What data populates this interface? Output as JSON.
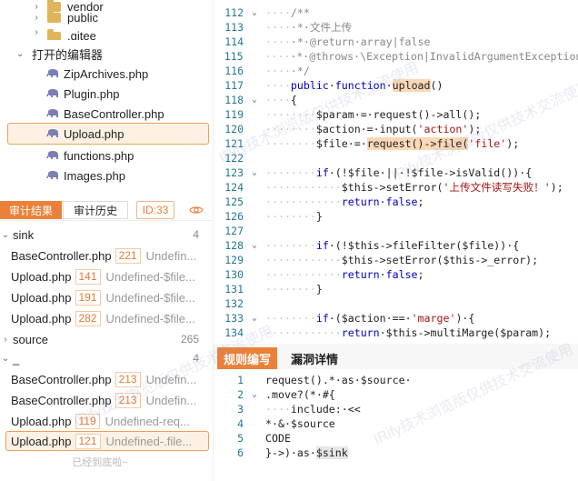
{
  "explorer": {
    "tree": [
      {
        "label": "vendor"
      },
      {
        "label": "public"
      },
      {
        "label": ".gitee"
      }
    ],
    "open_editors_title": "打开的编辑器",
    "open_files": [
      {
        "label": "ZipArchives.php"
      },
      {
        "label": "Plugin.php"
      },
      {
        "label": "BaseController.php"
      },
      {
        "label": "Upload.php"
      },
      {
        "label": "functions.php"
      },
      {
        "label": "Images.php"
      }
    ]
  },
  "audit": {
    "tab_results": "审计结果",
    "tab_history": "审计历史",
    "id_badge": "ID:33",
    "groups": [
      {
        "name": "sink",
        "count": "4",
        "items": [
          {
            "file": "BaseController.php",
            "line": "221",
            "msg": "Undefin..."
          },
          {
            "file": "Upload.php",
            "line": "141",
            "msg": "Undefined-$file..."
          },
          {
            "file": "Upload.php",
            "line": "191",
            "msg": "Undefined-$file..."
          },
          {
            "file": "Upload.php",
            "line": "282",
            "msg": "Undefined-$file..."
          }
        ]
      },
      {
        "name": "source",
        "count": "265"
      },
      {
        "name": "_",
        "count": "4",
        "items": [
          {
            "file": "BaseController.php",
            "line": "213",
            "msg": "Undefin..."
          },
          {
            "file": "BaseController.php",
            "line": "213",
            "msg": "Undefin..."
          },
          {
            "file": "Upload.php",
            "line": "119",
            "msg": "Undefined-req..."
          },
          {
            "file": "Upload.php",
            "line": "121",
            "msg": "Undefined-.file..."
          }
        ]
      }
    ],
    "end_text": "已经到底啦~"
  },
  "editor": {
    "lines": [
      {
        "n": "112",
        "fold": "⌄",
        "html": "<span class='dots'>····</span><span class='cm'>/**</span>"
      },
      {
        "n": "113",
        "fold": "",
        "html": "<span class='dots'>····</span><span class='cm'>·*·文件上传</span>"
      },
      {
        "n": "114",
        "fold": "",
        "html": "<span class='dots'>····</span><span class='cm'>·*·@return·array|false</span>"
      },
      {
        "n": "115",
        "fold": "",
        "html": "<span class='dots'>····</span><span class='cm'>·*·@throws·\\Exception|InvalidArgumentException</span>"
      },
      {
        "n": "116",
        "fold": "",
        "html": "<span class='dots'>····</span><span class='cm'>·*/</span>"
      },
      {
        "n": "117",
        "fold": "",
        "html": "<span class='dots'>····</span><span class='kw'>public</span>·<span class='kw'>function</span>·<span class='hl'>upload</span>()"
      },
      {
        "n": "118",
        "fold": "⌄",
        "html": "<span class='dots'>····</span>{"
      },
      {
        "n": "119",
        "fold": "",
        "html": "<span class='dots'>········</span>$param·=·request()->all();"
      },
      {
        "n": "120",
        "fold": "",
        "html": "<span class='dots'>········</span>$action·=·input(<span class='str'>'action'</span>);"
      },
      {
        "n": "121",
        "fold": "",
        "html": "<span class='dots'>········</span>$file·=·<span class='hl'>request()->file(</span><span class='str'>'file'</span>);"
      },
      {
        "n": "122",
        "fold": "",
        "html": ""
      },
      {
        "n": "123",
        "fold": "⌄",
        "html": "<span class='dots'>········</span><span class='kw'>if</span>·(!$file·||·!$file->isValid())·{"
      },
      {
        "n": "124",
        "fold": "",
        "html": "<span class='dots'>············</span>$this->setError(<span class='str'>'上传文件读写失败！'</span>);"
      },
      {
        "n": "125",
        "fold": "",
        "html": "<span class='dots'>············</span><span class='kw'>return</span>·<span class='kw'>false</span>;"
      },
      {
        "n": "126",
        "fold": "",
        "html": "<span class='dots'>········</span>}"
      },
      {
        "n": "127",
        "fold": "",
        "html": ""
      },
      {
        "n": "128",
        "fold": "⌄",
        "html": "<span class='dots'>········</span><span class='kw'>if</span>·(!$this->fileFilter($file))·{"
      },
      {
        "n": "129",
        "fold": "",
        "html": "<span class='dots'>············</span>$this->setError($this->_error);"
      },
      {
        "n": "130",
        "fold": "",
        "html": "<span class='dots'>············</span><span class='kw'>return</span>·<span class='kw'>false</span>;"
      },
      {
        "n": "131",
        "fold": "",
        "html": "<span class='dots'>········</span>}"
      },
      {
        "n": "132",
        "fold": "",
        "html": ""
      },
      {
        "n": "133",
        "fold": "⌄",
        "html": "<span class='dots'>········</span><span class='kw'>if</span>·($action·==·<span class='str'>'marge'</span>)·{"
      },
      {
        "n": "134",
        "fold": "",
        "html": "<span class='dots'>············</span><span class='kw'>return</span>·$this->multiMarge($param);"
      }
    ]
  },
  "rule_panel": {
    "tab_rule": "规则编写",
    "tab_detail": "漏洞详情",
    "lines": [
      {
        "n": "1",
        "fold": "",
        "html": "request().*·as·$source·"
      },
      {
        "n": "2",
        "fold": "⌄",
        "html": ".move?(*·#{"
      },
      {
        "n": "3",
        "fold": "",
        "html": "<span class='dots'>····</span>include:·<<<CODE"
      },
      {
        "n": "4",
        "fold": "",
        "html": "*·&·$source"
      },
      {
        "n": "5",
        "fold": "",
        "html": "CODE"
      },
      {
        "n": "6",
        "fold": "",
        "html": "}->)·as·<span style='background:#e6e6e6'>$sink</span>"
      }
    ]
  },
  "watermark": "IRify技术浏览版仅供技术交流使用"
}
